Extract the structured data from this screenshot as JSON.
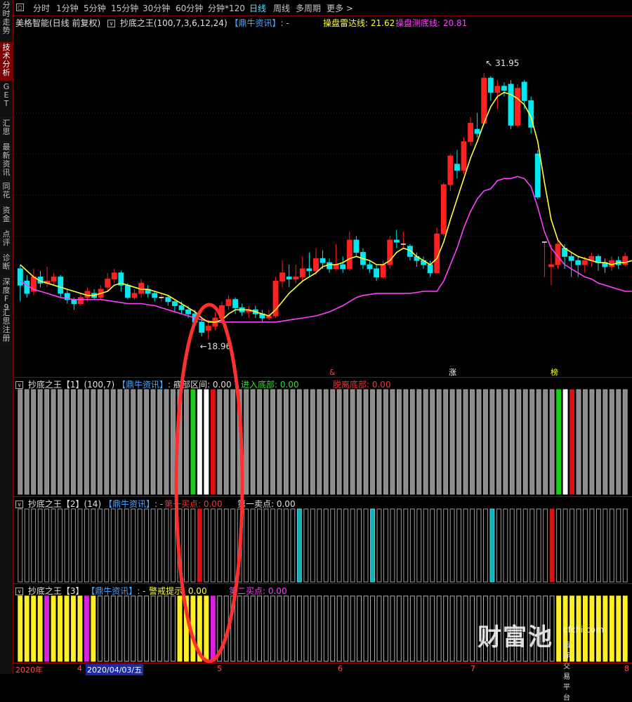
{
  "sidebar": {
    "items": [
      {
        "label": "分时走势",
        "active": false
      },
      {
        "label": "技术分析",
        "active": true
      },
      {
        "label": "GET",
        "active": false
      },
      {
        "label": "汇思",
        "active": false
      },
      {
        "label": "最新资讯",
        "active": false
      },
      {
        "label": "同花",
        "active": false
      },
      {
        "label": "资金",
        "active": false
      },
      {
        "label": "点评",
        "active": false
      },
      {
        "label": "诊断",
        "active": false
      },
      {
        "label": "深度F9",
        "active": false
      },
      {
        "label": "汇思注册",
        "active": false
      }
    ]
  },
  "toolbar": {
    "collapse_icon": "square-collapse-icon",
    "periods": [
      "分时",
      "1分钟",
      "5分钟",
      "15分钟",
      "30分钟",
      "60分钟",
      "分钟*120",
      "日线",
      "周线",
      "多周期",
      "更多 >"
    ],
    "active_period": "日线"
  },
  "main_panel": {
    "stock_title": "美格智能(日线 前复权)",
    "indicator": "抄底之王(100,7,3,6,12,24)",
    "source": "【鼎牛资讯】",
    "dash": ": -",
    "radar_label": "操盘雷达线: 21.62",
    "bottom_label": "操盘测底线: 20.81",
    "high_label": "31.95",
    "low_label": "18.96",
    "markers": [
      {
        "text": "&",
        "color": "#ff4040"
      },
      {
        "text": "涨",
        "color": "#ffffff"
      },
      {
        "text": "榜",
        "color": "#ffff3c"
      }
    ]
  },
  "panel1": {
    "title": "抄底之王【1】(100,7)",
    "source": "【鼎牛资讯】",
    "dash": ": -",
    "v1": "底部区间: 0.00",
    "v2": "进入底部: 0.00",
    "v3": "脱离底部: 0.00"
  },
  "panel2": {
    "title": "抄底之王【2】(14)",
    "source": "【鼎牛资讯】",
    "dash": ": -",
    "v1": "第一买点: 0.00",
    "v2": "第一卖点: 0.00"
  },
  "panel3": {
    "title": "抄底之王【3】",
    "source": "【鼎牛资讯】",
    "dash": ": -",
    "v1": "警戒提示: 0.00",
    "v2": "第二买点: 0.00"
  },
  "datebar": {
    "labels": [
      "2020年",
      "4",
      "2020/04/03/五",
      "5",
      "6",
      "7",
      "8"
    ],
    "selected": "2020/04/03/五"
  },
  "watermark": {
    "big": "财富池",
    "small1": "cfchi.com",
    "small2": "指标交易平台"
  },
  "colors": {
    "up": "#ff2020",
    "down": "#00e8f0",
    "radar_line": "#ffff3c",
    "bottom_line": "#ff40ff",
    "highlight_ellipse": "#ff3030"
  },
  "chart_data": {
    "type": "candlestick",
    "title": "美格智能(日线 前复权)",
    "y_range": [
      17.5,
      34
    ],
    "period_marks": [
      "2020年",
      "4",
      "5",
      "6",
      "7",
      "8"
    ],
    "candles": [
      {
        "o": 22.4,
        "c": 21.6,
        "h": 22.6,
        "l": 20.8
      },
      {
        "o": 21.8,
        "c": 21.2,
        "h": 22.1,
        "l": 21.0
      },
      {
        "o": 21.3,
        "c": 22.0,
        "h": 22.4,
        "l": 21.1
      },
      {
        "o": 22.0,
        "c": 21.7,
        "h": 22.3,
        "l": 21.5
      },
      {
        "o": 21.7,
        "c": 21.8,
        "h": 22.5,
        "l": 21.5
      },
      {
        "o": 21.8,
        "c": 22.0,
        "h": 22.2,
        "l": 21.6
      },
      {
        "o": 22.0,
        "c": 21.2,
        "h": 22.1,
        "l": 21.0
      },
      {
        "o": 21.2,
        "c": 20.9,
        "h": 21.4,
        "l": 20.7
      },
      {
        "o": 20.9,
        "c": 20.7,
        "h": 21.0,
        "l": 20.4
      },
      {
        "o": 20.7,
        "c": 21.0,
        "h": 21.2,
        "l": 20.6
      },
      {
        "o": 21.0,
        "c": 21.3,
        "h": 21.5,
        "l": 20.8
      },
      {
        "o": 21.2,
        "c": 21.0,
        "h": 21.4,
        "l": 20.9
      },
      {
        "o": 21.0,
        "c": 21.4,
        "h": 21.6,
        "l": 20.9
      },
      {
        "o": 21.5,
        "c": 21.9,
        "h": 22.2,
        "l": 21.3
      },
      {
        "o": 21.9,
        "c": 22.2,
        "h": 22.4,
        "l": 21.7
      },
      {
        "o": 22.2,
        "c": 21.6,
        "h": 22.3,
        "l": 21.3
      },
      {
        "o": 21.6,
        "c": 21.0,
        "h": 21.7,
        "l": 20.9
      },
      {
        "o": 21.0,
        "c": 21.2,
        "h": 21.4,
        "l": 20.9
      },
      {
        "o": 21.2,
        "c": 21.7,
        "h": 21.9,
        "l": 21.0
      },
      {
        "o": 21.4,
        "c": 21.2,
        "h": 21.6,
        "l": 21.0
      },
      {
        "o": 21.2,
        "c": 21.0,
        "h": 21.3,
        "l": 20.8
      },
      {
        "o": 21.0,
        "c": 21.0,
        "h": 21.2,
        "l": 20.8
      },
      {
        "o": 21.0,
        "c": 20.8,
        "h": 21.1,
        "l": 20.6
      },
      {
        "o": 20.8,
        "c": 20.6,
        "h": 20.9,
        "l": 20.3
      },
      {
        "o": 20.6,
        "c": 20.4,
        "h": 20.8,
        "l": 20.2
      },
      {
        "o": 20.4,
        "c": 20.2,
        "h": 20.6,
        "l": 20.0
      },
      {
        "o": 20.2,
        "c": 19.8,
        "h": 20.4,
        "l": 19.6
      },
      {
        "o": 19.8,
        "c": 19.3,
        "h": 20.0,
        "l": 19.1
      },
      {
        "o": 19.4,
        "c": 19.6,
        "h": 19.9,
        "l": 18.96
      },
      {
        "o": 19.6,
        "c": 20.0,
        "h": 20.3,
        "l": 19.4
      },
      {
        "o": 20.0,
        "c": 20.6,
        "h": 20.8,
        "l": 19.8
      },
      {
        "o": 20.6,
        "c": 20.9,
        "h": 21.1,
        "l": 20.4
      },
      {
        "o": 20.9,
        "c": 20.5,
        "h": 21.0,
        "l": 20.2
      },
      {
        "o": 20.5,
        "c": 20.3,
        "h": 20.7,
        "l": 20.1
      },
      {
        "o": 20.3,
        "c": 20.4,
        "h": 20.6,
        "l": 20.0
      },
      {
        "o": 20.4,
        "c": 20.2,
        "h": 20.6,
        "l": 20.0
      },
      {
        "o": 20.2,
        "c": 20.0,
        "h": 20.4,
        "l": 19.8
      },
      {
        "o": 20.0,
        "c": 20.1,
        "h": 20.4,
        "l": 19.9
      },
      {
        "o": 20.1,
        "c": 21.8,
        "h": 22.0,
        "l": 20.0
      },
      {
        "o": 21.8,
        "c": 22.2,
        "h": 22.8,
        "l": 21.5
      },
      {
        "o": 22.0,
        "c": 21.9,
        "h": 22.6,
        "l": 21.5
      },
      {
        "o": 21.9,
        "c": 22.0,
        "h": 22.6,
        "l": 21.7
      },
      {
        "o": 22.0,
        "c": 22.4,
        "h": 23.0,
        "l": 21.8
      },
      {
        "o": 22.4,
        "c": 22.3,
        "h": 23.2,
        "l": 22.0
      },
      {
        "o": 22.3,
        "c": 22.9,
        "h": 23.4,
        "l": 22.1
      },
      {
        "o": 22.9,
        "c": 22.7,
        "h": 23.3,
        "l": 22.4
      },
      {
        "o": 22.7,
        "c": 22.4,
        "h": 22.9,
        "l": 22.2
      },
      {
        "o": 22.4,
        "c": 22.6,
        "h": 23.6,
        "l": 22.3
      },
      {
        "o": 22.6,
        "c": 22.4,
        "h": 23.0,
        "l": 22.2
      },
      {
        "o": 22.4,
        "c": 23.8,
        "h": 24.2,
        "l": 22.3
      },
      {
        "o": 23.8,
        "c": 23.2,
        "h": 24.0,
        "l": 23.0
      },
      {
        "o": 23.2,
        "c": 22.6,
        "h": 23.4,
        "l": 22.4
      },
      {
        "o": 22.6,
        "c": 22.4,
        "h": 22.8,
        "l": 22.2
      },
      {
        "o": 22.4,
        "c": 22.0,
        "h": 22.6,
        "l": 21.8
      },
      {
        "o": 22.0,
        "c": 22.6,
        "h": 22.8,
        "l": 21.9
      },
      {
        "o": 22.6,
        "c": 23.8,
        "h": 24.0,
        "l": 22.4
      },
      {
        "o": 23.8,
        "c": 23.7,
        "h": 24.3,
        "l": 23.4
      },
      {
        "o": 23.6,
        "c": 23.6,
        "h": 24.2,
        "l": 23.4
      },
      {
        "o": 23.5,
        "c": 23.0,
        "h": 23.6,
        "l": 22.8
      },
      {
        "o": 23.0,
        "c": 22.8,
        "h": 23.2,
        "l": 22.5
      },
      {
        "o": 22.8,
        "c": 22.6,
        "h": 23.0,
        "l": 22.4
      },
      {
        "o": 22.6,
        "c": 22.2,
        "h": 22.8,
        "l": 22.0
      },
      {
        "o": 22.2,
        "c": 24.1,
        "h": 24.4,
        "l": 22.2
      },
      {
        "o": 24.1,
        "c": 26.5,
        "h": 26.6,
        "l": 24.0
      },
      {
        "o": 26.5,
        "c": 27.9,
        "h": 28.0,
        "l": 26.2
      },
      {
        "o": 27.5,
        "c": 27.2,
        "h": 28.2,
        "l": 26.8
      },
      {
        "o": 27.2,
        "c": 28.6,
        "h": 28.8,
        "l": 27.0
      },
      {
        "o": 28.6,
        "c": 29.5,
        "h": 29.8,
        "l": 28.4
      },
      {
        "o": 29.2,
        "c": 29.0,
        "h": 30.0,
        "l": 28.8
      },
      {
        "o": 29.5,
        "c": 31.7,
        "h": 31.95,
        "l": 29.4
      },
      {
        "o": 31.7,
        "c": 31.0,
        "h": 31.8,
        "l": 30.6
      },
      {
        "o": 31.0,
        "c": 31.3,
        "h": 31.6,
        "l": 30.2
      },
      {
        "o": 31.3,
        "c": 31.1,
        "h": 31.5,
        "l": 30.8
      },
      {
        "o": 31.4,
        "c": 29.4,
        "h": 31.6,
        "l": 29.2
      },
      {
        "o": 29.4,
        "c": 31.2,
        "h": 31.4,
        "l": 29.3
      },
      {
        "o": 31.5,
        "c": 30.6,
        "h": 31.6,
        "l": 30.2
      },
      {
        "o": 30.6,
        "c": 29.3,
        "h": 30.8,
        "l": 29.0
      },
      {
        "o": 28.0,
        "c": 25.9,
        "h": 28.2,
        "l": 25.8
      },
      {
        "o": 23.7,
        "c": 23.7,
        "h": 23.7,
        "l": 22.0
      },
      {
        "o": 22.5,
        "c": 22.6,
        "h": 23.6,
        "l": 21.6
      },
      {
        "o": 22.6,
        "c": 23.6,
        "h": 23.8,
        "l": 22.4
      },
      {
        "o": 23.4,
        "c": 23.0,
        "h": 23.6,
        "l": 22.4
      },
      {
        "o": 23.0,
        "c": 22.8,
        "h": 23.2,
        "l": 22.0
      },
      {
        "o": 22.8,
        "c": 22.6,
        "h": 23.0,
        "l": 22.0
      },
      {
        "o": 22.6,
        "c": 22.8,
        "h": 23.0,
        "l": 22.2
      },
      {
        "o": 22.8,
        "c": 23.0,
        "h": 23.2,
        "l": 22.5
      },
      {
        "o": 23.0,
        "c": 22.7,
        "h": 23.1,
        "l": 22.3
      },
      {
        "o": 22.7,
        "c": 22.5,
        "h": 22.9,
        "l": 22.2
      },
      {
        "o": 22.5,
        "c": 22.8,
        "h": 23.0,
        "l": 22.3
      },
      {
        "o": 22.8,
        "c": 22.6,
        "h": 23.0,
        "l": 22.4
      },
      {
        "o": 22.6,
        "c": 23.0,
        "h": 23.2,
        "l": 22.5
      }
    ],
    "radar_line": [
      22.6,
      22.3,
      22.0,
      21.8,
      21.7,
      21.6,
      21.5,
      21.4,
      21.3,
      21.2,
      21.1,
      21.1,
      21.2,
      21.3,
      21.6,
      21.7,
      21.6,
      21.5,
      21.4,
      21.4,
      21.3,
      21.2,
      21.1,
      20.9,
      20.7,
      20.5,
      20.3,
      20.0,
      19.8,
      19.8,
      19.9,
      20.2,
      20.4,
      20.4,
      20.4,
      20.3,
      20.2,
      20.1,
      20.4,
      20.8,
      21.2,
      21.5,
      21.8,
      22.0,
      22.2,
      22.5,
      22.6,
      22.6,
      22.7,
      22.9,
      23.0,
      22.9,
      22.8,
      22.6,
      22.6,
      22.8,
      23.2,
      23.4,
      23.3,
      23.0,
      22.8,
      22.6,
      22.9,
      23.7,
      24.8,
      25.8,
      26.8,
      27.8,
      28.6,
      29.5,
      30.3,
      30.8,
      31.0,
      30.9,
      30.7,
      30.4,
      29.8,
      28.6,
      26.6,
      24.8,
      23.8,
      23.4,
      23.2,
      23.0,
      22.9,
      22.8,
      22.7,
      22.7,
      22.6,
      22.7,
      22.7,
      22.8
    ],
    "bottom_line": [
      21.8,
      21.6,
      21.4,
      21.3,
      21.2,
      21.1,
      21.0,
      20.95,
      20.9,
      20.9,
      20.9,
      20.9,
      20.9,
      20.85,
      20.8,
      20.75,
      20.7,
      20.7,
      20.7,
      20.65,
      20.6,
      20.5,
      20.4,
      20.3,
      20.2,
      20.1,
      20.0,
      19.9,
      19.85,
      19.8,
      19.8,
      19.8,
      19.8,
      19.8,
      19.8,
      19.8,
      19.8,
      19.8,
      19.8,
      19.85,
      19.9,
      19.95,
      20.0,
      20.05,
      20.1,
      20.2,
      20.3,
      20.45,
      20.6,
      20.8,
      21.0,
      21.1,
      21.15,
      21.2,
      21.2,
      21.2,
      21.2,
      21.2,
      21.2,
      21.25,
      21.3,
      21.3,
      21.3,
      21.8,
      22.6,
      23.4,
      24.4,
      25.2,
      25.8,
      26.2,
      26.3,
      26.7,
      26.8,
      26.8,
      26.9,
      26.8,
      26.4,
      25.4,
      24.2,
      23.4,
      23.0,
      22.6,
      22.4,
      22.2,
      22.0,
      21.9,
      21.7,
      21.6,
      21.5,
      21.4,
      21.3,
      21.3
    ],
    "panel1_bars": [
      "g",
      "g",
      "g",
      "g",
      "g",
      "g",
      "g",
      "g",
      "g",
      "g",
      "g",
      "g",
      "g",
      "g",
      "g",
      "g",
      "g",
      "g",
      "g",
      "g",
      "g",
      "g",
      "g",
      "g",
      "g",
      "g",
      "G",
      "W",
      "W",
      "R",
      "g",
      "g",
      "g",
      "g",
      "g",
      "g",
      "g",
      "g",
      "g",
      "g",
      "g",
      "g",
      "g",
      "g",
      "g",
      "g",
      "g",
      "g",
      "g",
      "g",
      "g",
      "g",
      "g",
      "g",
      "g",
      "g",
      "g",
      "g",
      "g",
      "g",
      "g",
      "g",
      "g",
      "g",
      "g",
      "g",
      "g",
      "g",
      "g",
      "g",
      "g",
      "g",
      "g",
      "g",
      "g",
      "g",
      "g",
      "g",
      "g",
      "g",
      "g",
      "G",
      "W",
      "R",
      "g",
      "g",
      "g",
      "g",
      "g",
      "g",
      "g",
      "g"
    ],
    "panel2_bars": [
      "k",
      "k",
      "k",
      "k",
      "k",
      "k",
      "k",
      "k",
      "k",
      "k",
      "k",
      "k",
      "k",
      "k",
      "k",
      "k",
      "k",
      "k",
      "k",
      "k",
      "k",
      "k",
      "k",
      "k",
      "k",
      "k",
      "k",
      "R",
      "k",
      "k",
      "k",
      "k",
      "k",
      "k",
      "k",
      "k",
      "k",
      "k",
      "k",
      "k",
      "k",
      "k",
      "C",
      "k",
      "k",
      "k",
      "k",
      "k",
      "k",
      "k",
      "k",
      "k",
      "k",
      "C",
      "k",
      "k",
      "k",
      "k",
      "k",
      "k",
      "k",
      "k",
      "k",
      "k",
      "k",
      "k",
      "k",
      "k",
      "k",
      "k",
      "k",
      "C",
      "k",
      "k",
      "k",
      "k",
      "k",
      "k",
      "k",
      "k",
      "R",
      "k",
      "k",
      "k",
      "k",
      "k",
      "k",
      "k",
      "k",
      "k",
      "k",
      "k"
    ],
    "panel3_bars": [
      "Y",
      "Y",
      "Y",
      "Y",
      "M",
      "Y",
      "Y",
      "Y",
      "Y",
      "Y",
      "M",
      "Y",
      "k",
      "k",
      "k",
      "k",
      "k",
      "k",
      "k",
      "k",
      "k",
      "k",
      "k",
      "k",
      "Y",
      "Y",
      "Y",
      "Y",
      "Y",
      "M",
      "k",
      "k",
      "k",
      "k",
      "k",
      "k",
      "k",
      "k",
      "k",
      "k",
      "k",
      "k",
      "k",
      "k",
      "k",
      "k",
      "k",
      "k",
      "k",
      "k",
      "k",
      "k",
      "k",
      "k",
      "k",
      "k",
      "k",
      "k",
      "k",
      "k",
      "k",
      "k",
      "k",
      "k",
      "k",
      "k",
      "k",
      "k",
      "k",
      "k",
      "k",
      "k",
      "k",
      "k",
      "k",
      "k",
      "k",
      "k",
      "k",
      "k",
      "k",
      "Y",
      "Y",
      "Y",
      "Y",
      "Y",
      "Y",
      "Y",
      "Y",
      "Y",
      "Y",
      "Y"
    ]
  }
}
